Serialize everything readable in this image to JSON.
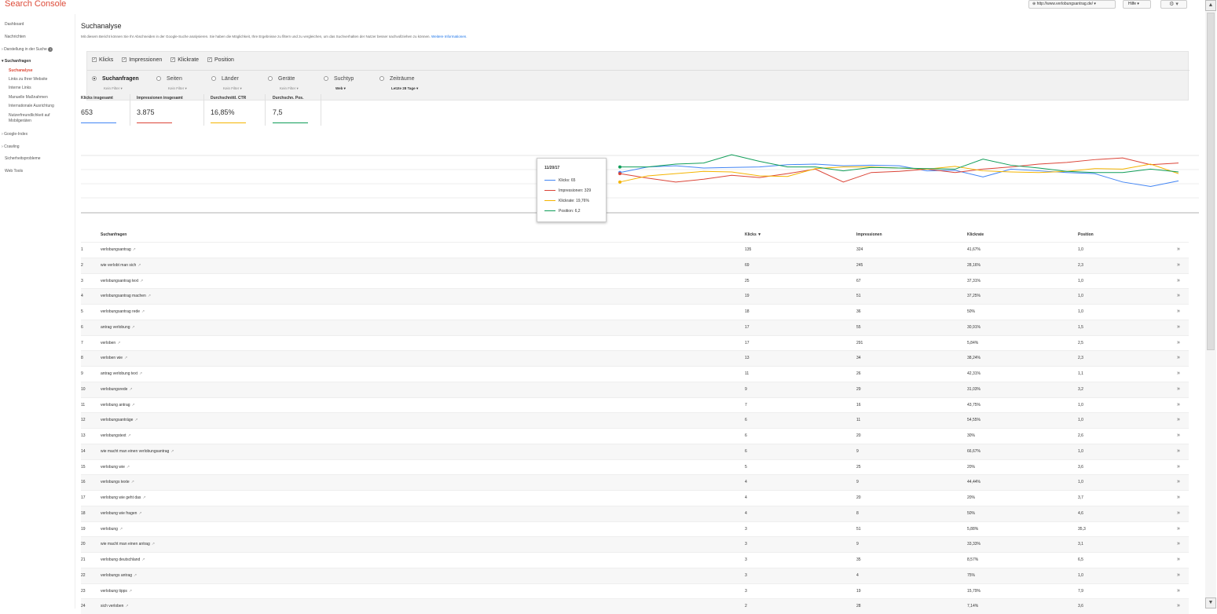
{
  "header": {
    "app_title": "Search Console",
    "site": "http://www.verlobungsantrag.de/",
    "help_label": "Hilfe",
    "gear_icon": "gear-icon"
  },
  "sidebar": {
    "items": [
      {
        "label": "Dashboard"
      },
      {
        "label": "Nachrichten"
      },
      {
        "label": "Darstellung in der Suche"
      },
      {
        "label": "Suchanfragen"
      },
      {
        "label": "Suchanalyse"
      },
      {
        "label": "Links zu Ihrer Website"
      },
      {
        "label": "Interne Links"
      },
      {
        "label": "Manuelle Maßnahmen"
      },
      {
        "label": "Internationale Ausrichtung"
      },
      {
        "label": "Nutzerfreundlichkeit auf Mobilgeräten"
      },
      {
        "label": "Google-Index"
      },
      {
        "label": "Crawling"
      },
      {
        "label": "Sicherheitsprobleme"
      },
      {
        "label": "Web Tools"
      }
    ]
  },
  "page": {
    "title": "Suchanalyse",
    "description": "Mit diesem Bericht können Sie Ihr Abschneiden in der Google-Suche analysieren. Sie haben die Möglichkeit, Ihre Ergebnisse zu filtern und zu vergleichen, um das Suchverhalten der Nutzer besser nachvollziehen zu können.",
    "more_link": "Weitere Informationen."
  },
  "metrics": [
    {
      "label": "Klicks",
      "checked": true
    },
    {
      "label": "Impressionen",
      "checked": true
    },
    {
      "label": "Klickrate",
      "checked": true
    },
    {
      "label": "Position",
      "checked": true
    }
  ],
  "dimensions": [
    {
      "label": "Suchanfragen",
      "sub": "Kein Filter",
      "selected": true
    },
    {
      "label": "Seiten",
      "sub": "Kein Filter",
      "selected": false
    },
    {
      "label": "Länder",
      "sub": "Kein Filter",
      "selected": false
    },
    {
      "label": "Geräte",
      "sub": "Kein Filter",
      "selected": false
    },
    {
      "label": "Suchtyp",
      "sub": "Web",
      "selected": false
    },
    {
      "label": "Zeiträume",
      "sub": "Letzte 28 Tage",
      "selected": false
    }
  ],
  "kpis": [
    {
      "label": "Klicks insgesamt",
      "value": "653",
      "color": "#4285f4"
    },
    {
      "label": "Impressionen insgesamt",
      "value": "3.875",
      "color": "#db4437"
    },
    {
      "label": "Durchschnittl. CTR",
      "value": "16,85%",
      "color": "#f4b400"
    },
    {
      "label": "Durchschn. Pos.",
      "value": "7,5",
      "color": "#0f9d58"
    }
  ],
  "chart_data": {
    "type": "line",
    "series": [
      {
        "name": "Klicks",
        "color": "#4285f4",
        "values": [
          0.72,
          0.82,
          0.84,
          0.8,
          0.81,
          0.82,
          0.86,
          0.87,
          0.84,
          0.85,
          0.84,
          0.75,
          0.76,
          0.64,
          0.78,
          0.75,
          0.72,
          0.7,
          0.55,
          0.47,
          0.57
        ]
      },
      {
        "name": "Impressionen",
        "color": "#db4437",
        "values": [
          0.7,
          0.62,
          0.55,
          0.6,
          0.67,
          0.63,
          0.7,
          0.78,
          0.55,
          0.72,
          0.74,
          0.78,
          0.72,
          0.78,
          0.82,
          0.87,
          0.9,
          0.95,
          0.98,
          0.86,
          0.89
        ]
      },
      {
        "name": "Klickrate",
        "color": "#f4b400",
        "values": [
          0.55,
          0.66,
          0.7,
          0.74,
          0.73,
          0.66,
          0.65,
          0.79,
          0.82,
          0.82,
          0.8,
          0.78,
          0.83,
          0.75,
          0.73,
          0.72,
          0.74,
          0.79,
          0.78,
          0.87,
          0.7
        ]
      },
      {
        "name": "Position",
        "color": "#0f9d58",
        "values": [
          0.82,
          0.82,
          0.87,
          0.89,
          1.08,
          0.92,
          0.82,
          0.82,
          0.75,
          0.81,
          0.8,
          0.79,
          0.78,
          0.96,
          0.85,
          0.8,
          0.74,
          0.72,
          0.72,
          0.78,
          0.73
        ]
      }
    ]
  },
  "tooltip": {
    "date": "11/20/17",
    "rows": [
      {
        "text": "Klicks: 65",
        "color": "#4285f4"
      },
      {
        "text": "Impressionen: 329",
        "color": "#db4437"
      },
      {
        "text": "Klickrate: 19,76%",
        "color": "#f4b400"
      },
      {
        "text": "Position: 6,2",
        "color": "#0f9d58"
      }
    ]
  },
  "table": {
    "headers": {
      "query": "Suchanfragen",
      "clicks": "Klicks ▼",
      "impressions": "Impressionen",
      "ctr": "Klickrate",
      "position": "Position"
    },
    "rows": [
      {
        "n": "1",
        "q": "verlobungsantrag",
        "c": "135",
        "i": "324",
        "ctr": "41,67%",
        "p": "1,0"
      },
      {
        "n": "2",
        "q": "wie verlobt man sich",
        "c": "69",
        "i": "245",
        "ctr": "28,16%",
        "p": "2,3"
      },
      {
        "n": "3",
        "q": "verlobungsantrag text",
        "c": "25",
        "i": "67",
        "ctr": "37,31%",
        "p": "1,0"
      },
      {
        "n": "4",
        "q": "verlobungsantrag machen",
        "c": "19",
        "i": "51",
        "ctr": "37,25%",
        "p": "1,0"
      },
      {
        "n": "5",
        "q": "verlobungsantrag rede",
        "c": "18",
        "i": "36",
        "ctr": "50%",
        "p": "1,0"
      },
      {
        "n": "6",
        "q": "antrag verlobung",
        "c": "17",
        "i": "55",
        "ctr": "30,91%",
        "p": "1,5"
      },
      {
        "n": "7",
        "q": "verloben",
        "c": "17",
        "i": "291",
        "ctr": "5,84%",
        "p": "2,5"
      },
      {
        "n": "8",
        "q": "verloben wie",
        "c": "13",
        "i": "34",
        "ctr": "38,24%",
        "p": "2,3"
      },
      {
        "n": "9",
        "q": "antrag verlobung text",
        "c": "11",
        "i": "26",
        "ctr": "42,31%",
        "p": "1,1"
      },
      {
        "n": "10",
        "q": "verlobungsrede",
        "c": "9",
        "i": "29",
        "ctr": "31,03%",
        "p": "3,2"
      },
      {
        "n": "11",
        "q": "verlobung antrag",
        "c": "7",
        "i": "16",
        "ctr": "43,75%",
        "p": "1,0"
      },
      {
        "n": "12",
        "q": "verlobungsanträge",
        "c": "6",
        "i": "11",
        "ctr": "54,55%",
        "p": "1,0"
      },
      {
        "n": "13",
        "q": "verlobungstext",
        "c": "6",
        "i": "20",
        "ctr": "30%",
        "p": "2,6"
      },
      {
        "n": "14",
        "q": "wie macht man einen verlobungsantrag",
        "c": "6",
        "i": "9",
        "ctr": "66,67%",
        "p": "1,0"
      },
      {
        "n": "15",
        "q": "verlobung wie",
        "c": "5",
        "i": "25",
        "ctr": "20%",
        "p": "3,6"
      },
      {
        "n": "16",
        "q": "verlobungs texte",
        "c": "4",
        "i": "9",
        "ctr": "44,44%",
        "p": "1,0"
      },
      {
        "n": "17",
        "q": "verlobung wie geht das",
        "c": "4",
        "i": "20",
        "ctr": "20%",
        "p": "3,7"
      },
      {
        "n": "18",
        "q": "verlobung wie fragen",
        "c": "4",
        "i": "8",
        "ctr": "50%",
        "p": "4,6"
      },
      {
        "n": "19",
        "q": "verlobung",
        "c": "3",
        "i": "51",
        "ctr": "5,88%",
        "p": "35,3"
      },
      {
        "n": "20",
        "q": "wie macht man einen antrag",
        "c": "3",
        "i": "9",
        "ctr": "33,33%",
        "p": "3,1"
      },
      {
        "n": "21",
        "q": "verlobung deutschland",
        "c": "3",
        "i": "35",
        "ctr": "8,57%",
        "p": "6,5"
      },
      {
        "n": "22",
        "q": "verlobungs antrag",
        "c": "3",
        "i": "4",
        "ctr": "75%",
        "p": "1,0"
      },
      {
        "n": "23",
        "q": "verlobung tipps",
        "c": "3",
        "i": "19",
        "ctr": "15,79%",
        "p": "7,9"
      },
      {
        "n": "24",
        "q": "sich verloben",
        "c": "2",
        "i": "28",
        "ctr": "7,14%",
        "p": "3,6"
      }
    ]
  }
}
